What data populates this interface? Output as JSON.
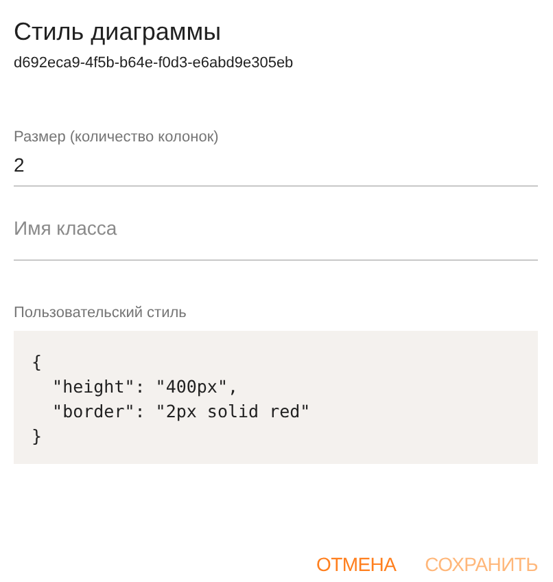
{
  "dialog": {
    "title": "Стиль диаграммы",
    "subtitle": "d692eca9-4f5b-b64e-f0d3-e6abd9e305eb"
  },
  "size_field": {
    "label": "Размер (количество колонок)",
    "value": "2"
  },
  "class_field": {
    "placeholder": "Имя класса"
  },
  "custom_style": {
    "label": "Пользовательский стиль",
    "code_lines": [
      "{",
      "  \"height\": \"400px\",",
      "  \"border\": \"2px solid red\"",
      "}"
    ]
  },
  "buttons": [
    {
      "label": "ОТМЕНА",
      "disabled": false
    },
    {
      "label": "СОХРАНИТЬ",
      "disabled": true
    }
  ]
}
